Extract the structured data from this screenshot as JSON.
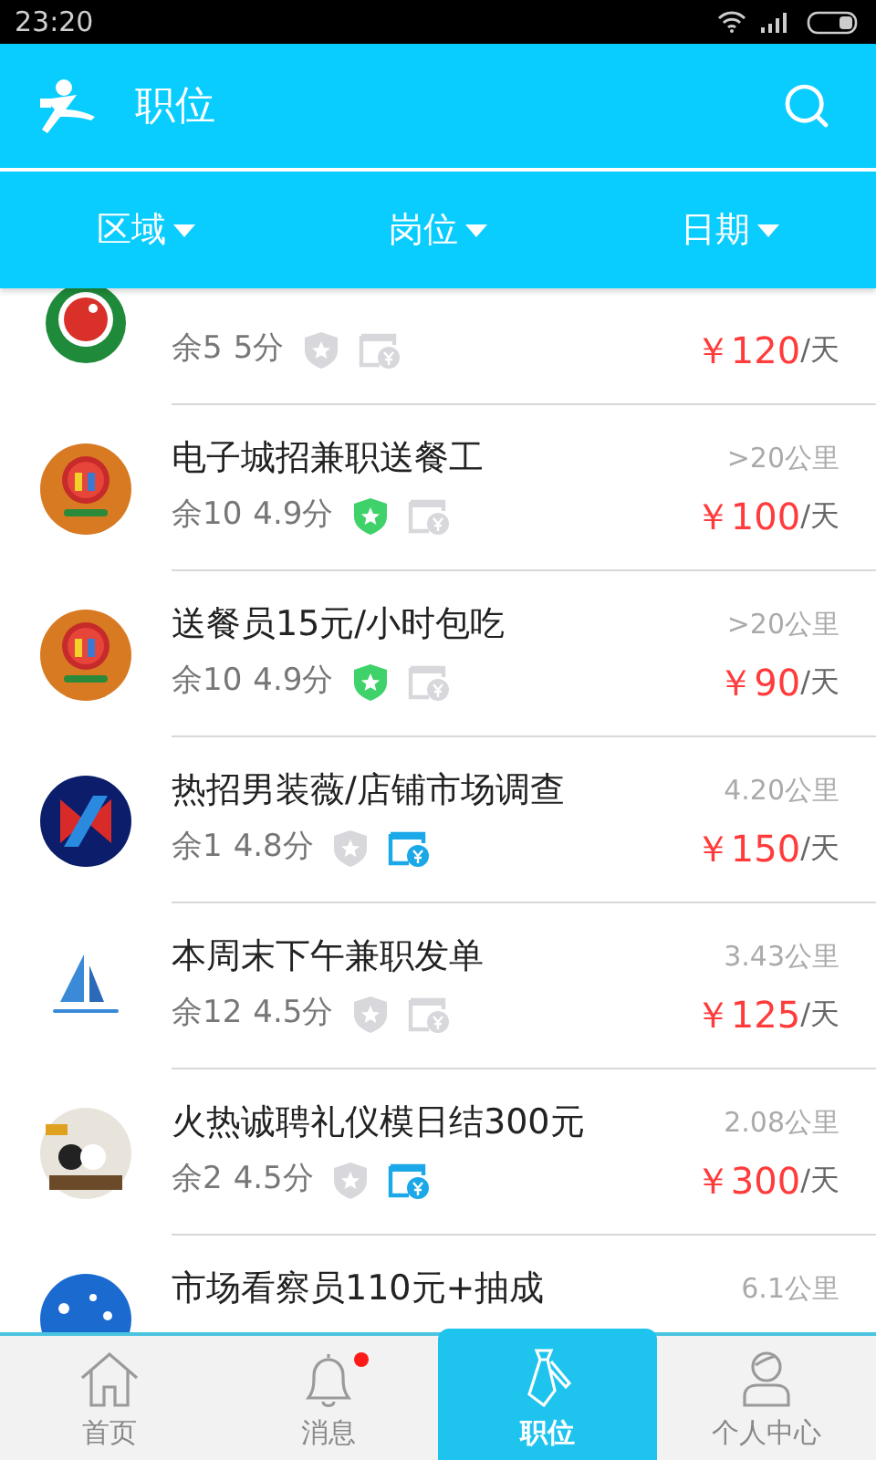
{
  "status_bar": {
    "time": "23:20"
  },
  "header": {
    "title": "职位"
  },
  "filters": [
    {
      "label": "区域"
    },
    {
      "label": "岗位"
    },
    {
      "label": "日期"
    }
  ],
  "jobs": [
    {
      "remaining": "余5",
      "rating": "5分",
      "verified": false,
      "guaranteed": false,
      "price": "￥120",
      "unit": "/天"
    },
    {
      "title": "电子城招兼职送餐工",
      "distance": ">20公里",
      "remaining": "余10",
      "rating": "4.9分",
      "verified": true,
      "guaranteed": false,
      "price": "￥100",
      "unit": "/天"
    },
    {
      "title": "送餐员15元/小时包吃",
      "distance": ">20公里",
      "remaining": "余10",
      "rating": "4.9分",
      "verified": true,
      "guaranteed": false,
      "price": "￥90",
      "unit": "/天"
    },
    {
      "title": "热招男装薇/店铺市场调查",
      "distance": "4.20公里",
      "remaining": "余1",
      "rating": "4.8分",
      "verified": false,
      "guaranteed": true,
      "price": "￥150",
      "unit": "/天"
    },
    {
      "title": "本周末下午兼职发单",
      "distance": "3.43公里",
      "remaining": "余12",
      "rating": "4.5分",
      "verified": false,
      "guaranteed": false,
      "price": "￥125",
      "unit": "/天"
    },
    {
      "title": "火热诚聘礼仪模日结300元",
      "distance": "2.08公里",
      "remaining": "余2",
      "rating": "4.5分",
      "verified": false,
      "guaranteed": true,
      "price": "￥300",
      "unit": "/天"
    },
    {
      "title": "市场看察员110元+抽成",
      "distance": "6.1公里"
    }
  ],
  "tabs": [
    {
      "kind": "home",
      "label": "首页",
      "selected": false,
      "dot": false
    },
    {
      "kind": "bell",
      "label": "消息",
      "selected": false,
      "dot": true
    },
    {
      "kind": "tie",
      "label": "职位",
      "selected": true,
      "dot": false
    },
    {
      "kind": "person",
      "label": "个人中心",
      "selected": false,
      "dot": false
    }
  ]
}
